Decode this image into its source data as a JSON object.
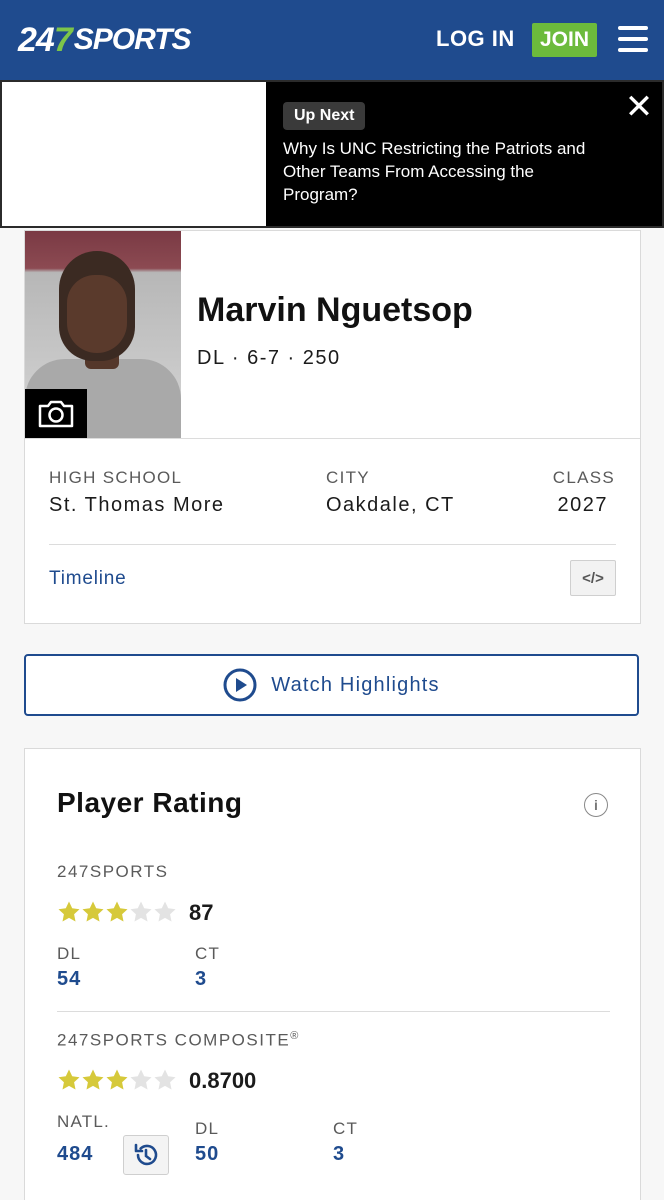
{
  "header": {
    "logo_num_a": "24",
    "logo_num_b": "7",
    "logo_word": "SPORTS",
    "login_label": "LOG IN",
    "join_label": "JOIN",
    "brand_color": "#1f4b8e",
    "join_color": "#6cbb3c"
  },
  "up_next": {
    "badge": "Up Next",
    "headline": "Why Is UNC Restricting the Patriots and Other Teams From Accessing the Program?",
    "close_icon": "close-icon"
  },
  "player": {
    "name": "Marvin Nguetsop",
    "meta": "DL · 6-7 · 250",
    "camera_icon": "camera-icon",
    "info": [
      {
        "label": "HIGH SCHOOL",
        "value": "St. Thomas More"
      },
      {
        "label": "CITY",
        "value": "Oakdale, CT"
      },
      {
        "label": "CLASS",
        "value": "2027"
      }
    ],
    "timeline_label": "Timeline",
    "embed_label": "</>"
  },
  "highlights": {
    "label": "Watch Highlights",
    "icon": "play-circle-icon"
  },
  "rating": {
    "title": "Player Rating",
    "info_icon": "i",
    "sports247": {
      "label": "247SPORTS",
      "stars": 3,
      "max_stars": 5,
      "score": "87",
      "ranks": [
        {
          "label": "DL",
          "value": "54"
        },
        {
          "label": "CT",
          "value": "3"
        }
      ]
    },
    "composite": {
      "label": "247SPORTS COMPOSITE",
      "registered": "®",
      "stars": 3,
      "max_stars": 5,
      "score": "0.8700",
      "ranks": [
        {
          "label": "NATL.",
          "value": "484"
        },
        {
          "label": "DL",
          "value": "50"
        },
        {
          "label": "CT",
          "value": "3"
        }
      ],
      "history_icon": "history-icon"
    },
    "star_color": "#d6c93a",
    "star_empty_color": "#e3e3e3"
  }
}
